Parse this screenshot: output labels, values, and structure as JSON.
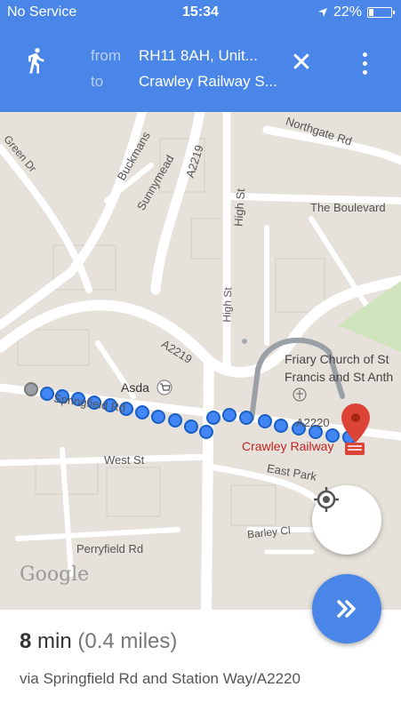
{
  "status": {
    "carrier": "No Service",
    "time": "15:34",
    "battery": "22%",
    "battery_level": 0.22,
    "icons": [
      "location-arrow-icon",
      "battery-icon"
    ]
  },
  "toolbar": {
    "mode_icon": "walk-icon",
    "from_label": "from",
    "from_value": "RH11 8AH, Unit...",
    "to_label": "to",
    "to_value": "Crawley Railway S...",
    "close_icon": "close-icon",
    "menu_icon": "more-vert-icon"
  },
  "map": {
    "streets": [
      "Northgate Rd",
      "Buckmans",
      "Sunnymead",
      "A2219",
      "High St",
      "The Boulevard",
      "High St",
      "A2219",
      "Friary Church of St",
      "Francis and St Anth",
      "Asda",
      "Springfield Rd",
      "A2220",
      "Crawley Railway",
      "West St",
      "East Park",
      "Barley Cl",
      "Perryfield Rd",
      "Green Dr"
    ],
    "logo": "Google",
    "route_color": "#4285f4"
  },
  "summary": {
    "duration_num": "8",
    "duration_unit": " min",
    "distance": "(0.4 miles)",
    "via": "via Springfield Rd and Station Way/A2220"
  },
  "colors": {
    "primary": "#4a86e8",
    "map_bg": "#e6e2db",
    "road": "#ffffff",
    "route": "#4285f4",
    "pin": "#db4437"
  }
}
